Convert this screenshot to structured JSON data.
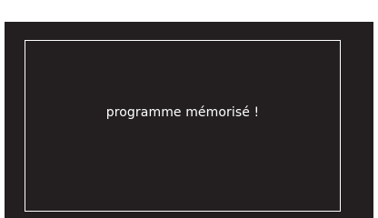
{
  "display": {
    "message": "programme mémorisé !"
  },
  "colors": {
    "screen_background": "#231f20",
    "frame_border": "#ffffff",
    "text": "#ffffff"
  }
}
